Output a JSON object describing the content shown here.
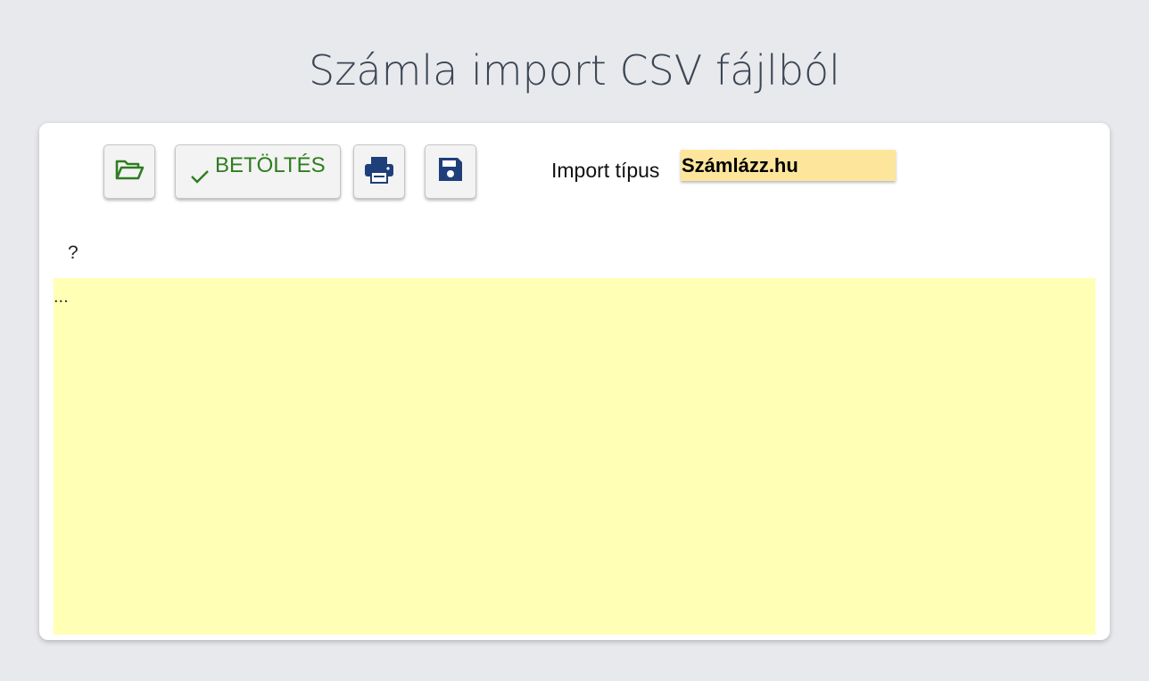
{
  "page": {
    "title": "Számla import CSV fájlból"
  },
  "toolbar": {
    "open_icon": "folder-open-icon",
    "load_label": "BETÖLTÉS",
    "load_icon": "check-icon",
    "print_icon": "printer-icon",
    "save_icon": "floppy-disk-icon"
  },
  "import": {
    "label": "Import típus",
    "selected": "Számlázz.hu"
  },
  "help": {
    "text": "?"
  },
  "content": {
    "text": "..."
  },
  "colors": {
    "background": "#e8e9ec",
    "title": "#3b4656",
    "green": "#2e7d1f",
    "navy": "#1f3f7a",
    "select_bg": "#fde69c",
    "textarea_bg": "#ffffb5"
  }
}
